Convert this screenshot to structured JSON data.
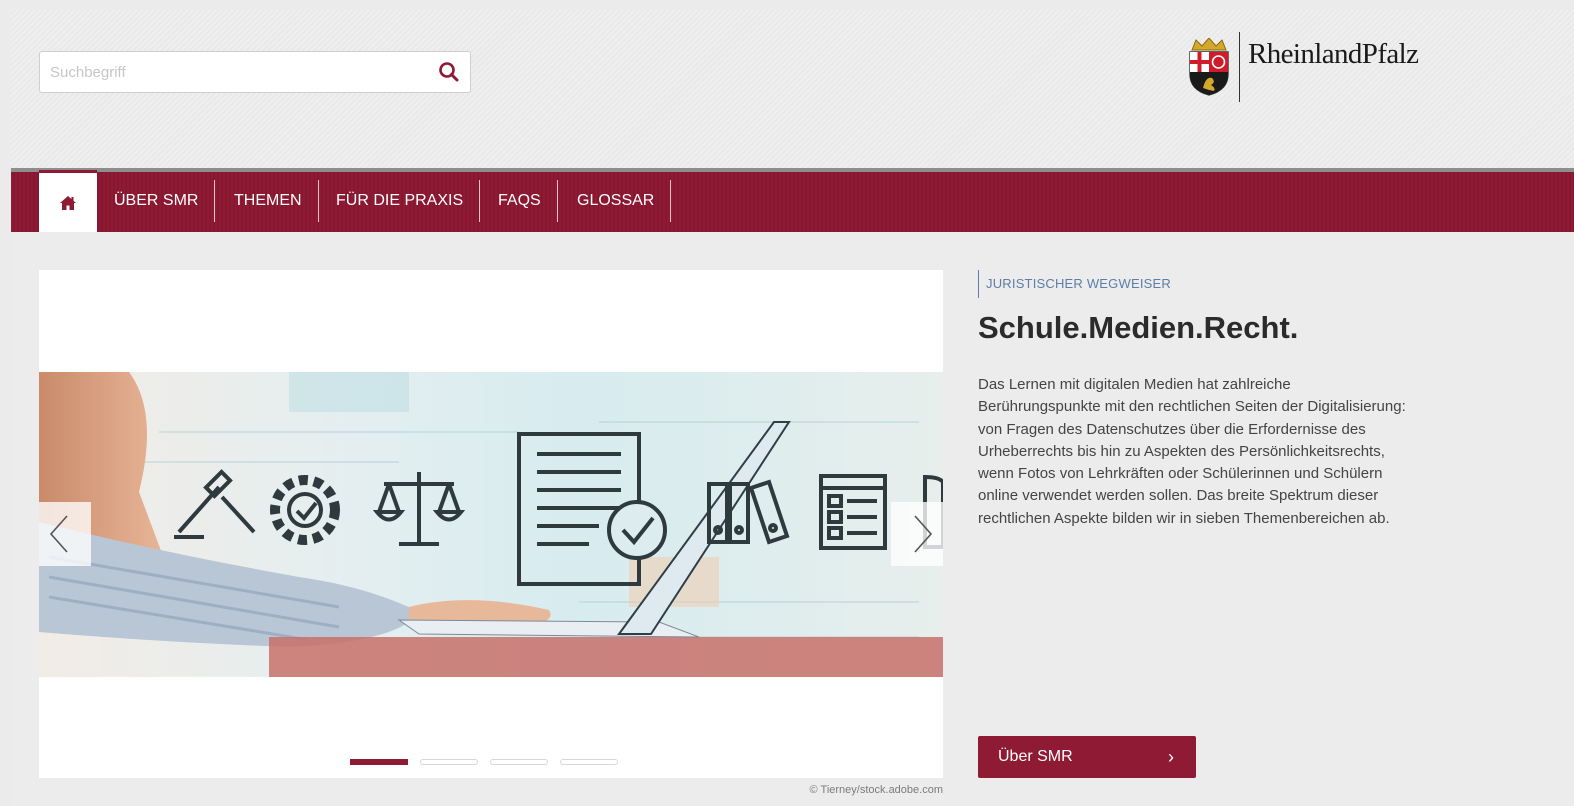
{
  "search": {
    "placeholder": "Suchbegriff"
  },
  "logo": {
    "text": "RheinlandPfalz"
  },
  "nav": {
    "home_icon": "home-icon",
    "items": [
      {
        "label": "ÜBER SMR"
      },
      {
        "label": "THEMEN"
      },
      {
        "label": "FÜR DIE PRAXIS"
      },
      {
        "label": "FAQS"
      },
      {
        "label": "GLOSSAR"
      }
    ]
  },
  "slider": {
    "slide_count": 4,
    "active_index": 0,
    "prev_icon": "chevron-left-icon",
    "next_icon": "chevron-right-icon",
    "credit": "© Tierney/stock.adobe.com"
  },
  "teaser": {
    "kicker": "JURISTISCHER WEGWEISER",
    "title": "Schule.Medien.Recht.",
    "body": "Das Lernen mit digitalen Medien hat zahlreiche Berührungspunkte mit den rechtlichen Seiten der Digitalisierung: von Fragen des Datenschutzes über die Erfordernisse des Urheberrechts bis hin zu Aspekten des Persönlichkeitsrechts, wenn Fotos von Lehrkräften oder Schülerinnen und Schülern online verwendet werden sollen. Das breite Spektrum dieser rechtlichen Aspekte bilden wir in sieben Themenbereichen ab.",
    "button_label": "Über SMR",
    "button_icon": "chevron-right-icon"
  },
  "colors": {
    "brand": "#8f1a33",
    "kicker": "#5d7ea8",
    "text": "#444444",
    "background": "#ececec"
  }
}
